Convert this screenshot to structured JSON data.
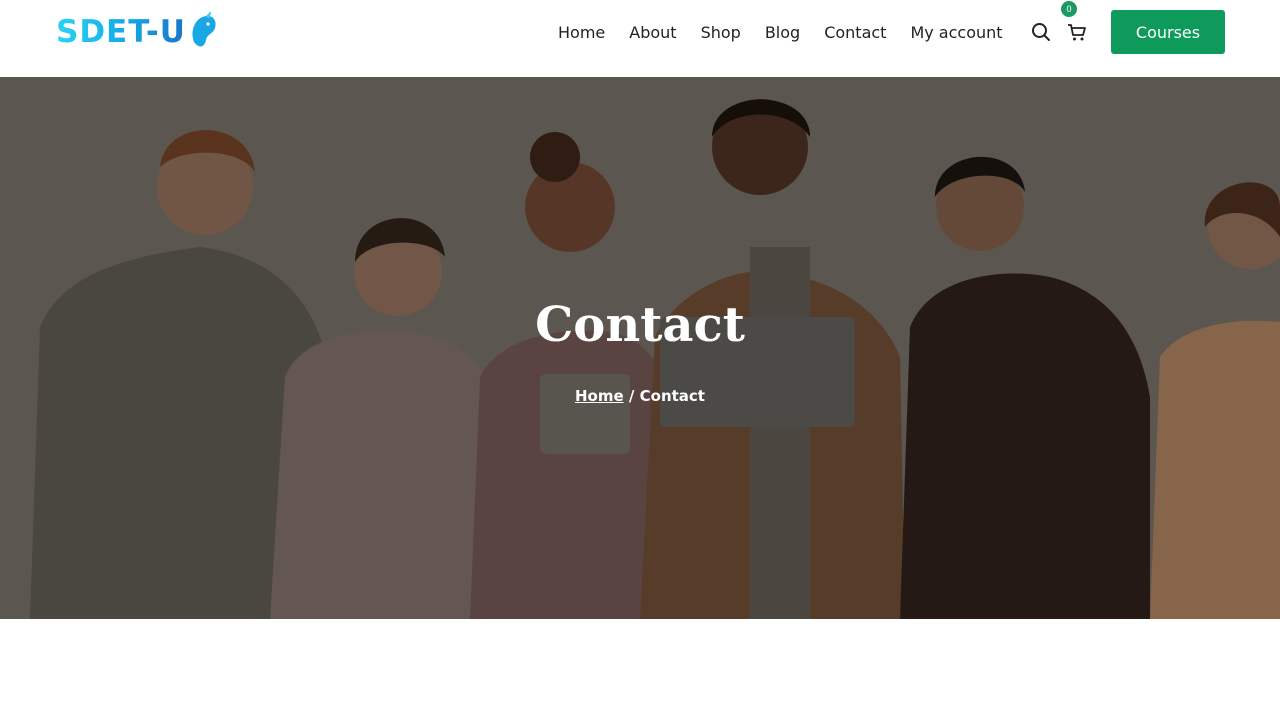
{
  "logo": {
    "text": "SDET-U"
  },
  "nav": {
    "items": [
      {
        "label": "Home"
      },
      {
        "label": "About"
      },
      {
        "label": "Shop"
      },
      {
        "label": "Blog"
      },
      {
        "label": "Contact"
      },
      {
        "label": "My account"
      }
    ]
  },
  "header_icons": {
    "search": "search-icon",
    "cart": "cart-icon",
    "cart_count": "0"
  },
  "cta": {
    "label": "Courses"
  },
  "hero": {
    "title": "Contact",
    "breadcrumb": {
      "home": "Home",
      "separator": "/",
      "current": "Contact"
    }
  },
  "colors": {
    "accent": "#0e9a5b",
    "badge": "#1d9a63",
    "logo_gradient_start": "#2ad3f5",
    "logo_gradient_end": "#1b74c9"
  }
}
